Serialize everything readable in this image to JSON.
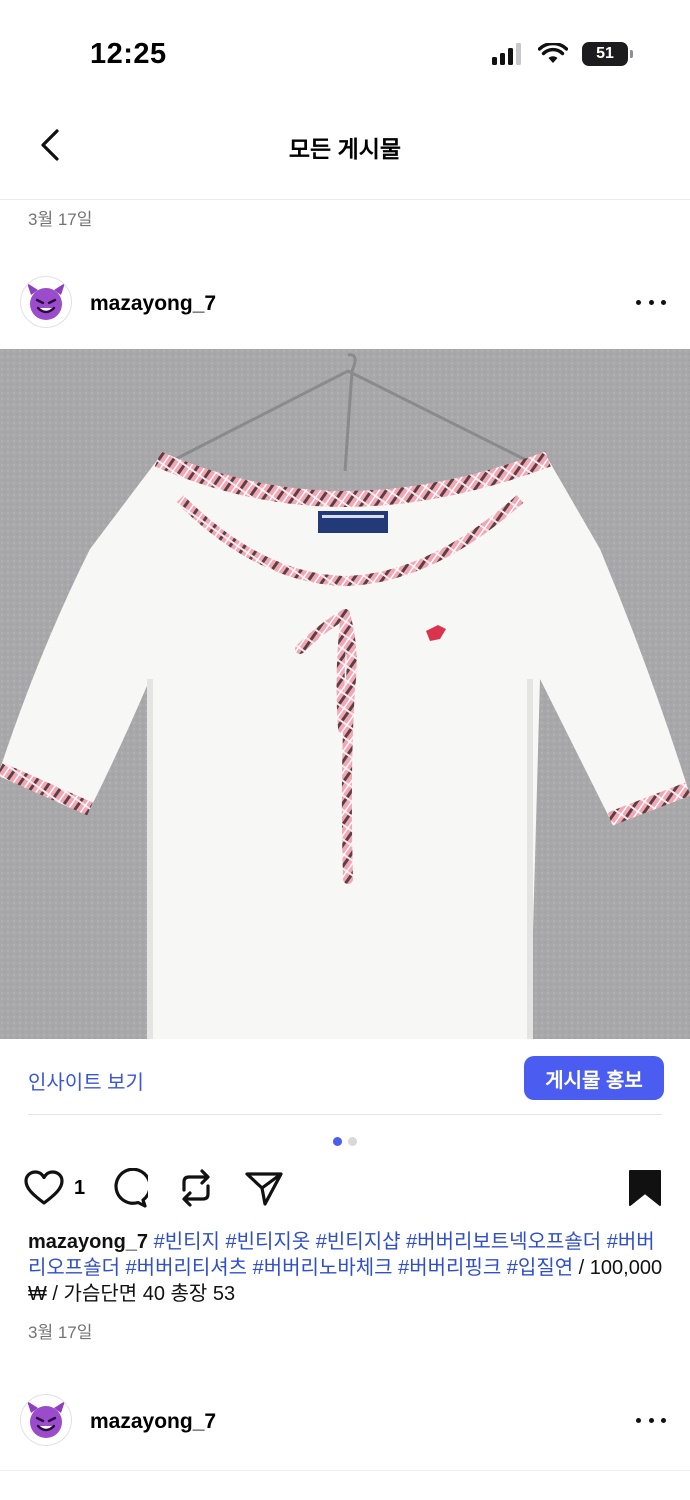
{
  "status_bar": {
    "time": "12:25",
    "battery": "51"
  },
  "nav": {
    "title": "모든 게시물"
  },
  "feed": {
    "date_top": "3월 17일",
    "post": {
      "username": "mazayong_7",
      "insight_label": "인사이트 보기",
      "promote_label": "게시물 홍보",
      "carousel": {
        "count": 2,
        "active": 1
      },
      "like_count": "1",
      "caption_user": "mazayong_7",
      "caption_tags": "#빈티지 #빈티지옷 #빈티지샵 #버버리보트넥오프숄더 #버버리오프숄더 #버버리티셔츠 #버버리노바체크 #버버리핑크 #입질연",
      "caption_rest": " / 100,000 ₩ / 가슴단면 40 총장 53",
      "date": "3월 17일"
    },
    "next_post": {
      "username": "mazayong_7"
    }
  },
  "icons": {
    "back": "chevron-left-icon",
    "more": "more-horizontal-icon",
    "like": "heart-icon",
    "comment": "comment-icon",
    "repost": "repost-icon",
    "share": "send-icon",
    "save": "bookmark-filled-icon",
    "avatar": "smiling-devil-emoji"
  },
  "colors": {
    "accent": "#4a5df0",
    "link": "#3b55d9",
    "hashtag": "#2f4fc9",
    "muted": "#737373"
  }
}
